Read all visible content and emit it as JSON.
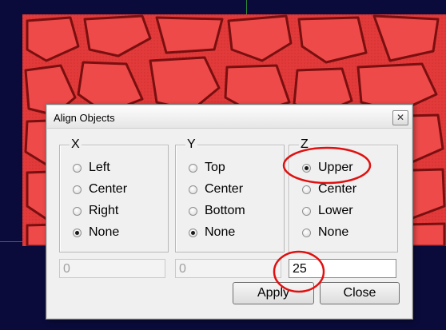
{
  "dialog": {
    "title": "Align Objects",
    "close_glyph": "✕"
  },
  "groups": {
    "x": {
      "label": "X",
      "options": [
        "Left",
        "Center",
        "Right",
        "None"
      ],
      "selected": "None"
    },
    "y": {
      "label": "Y",
      "options": [
        "Top",
        "Center",
        "Bottom",
        "None"
      ],
      "selected": "None"
    },
    "z": {
      "label": "Z",
      "options": [
        "Upper",
        "Center",
        "Lower",
        "None"
      ],
      "selected": "Upper"
    }
  },
  "fields": {
    "x_value": "0",
    "y_value": "0",
    "z_value": "25"
  },
  "buttons": {
    "apply": "Apply",
    "close": "Close"
  },
  "colors": {
    "viewport_bg": "#0a0b3a",
    "relief": "#e23a3a",
    "annotation": "#e01010"
  },
  "icons": {
    "close": "close-icon",
    "radio": "radio-icon"
  }
}
